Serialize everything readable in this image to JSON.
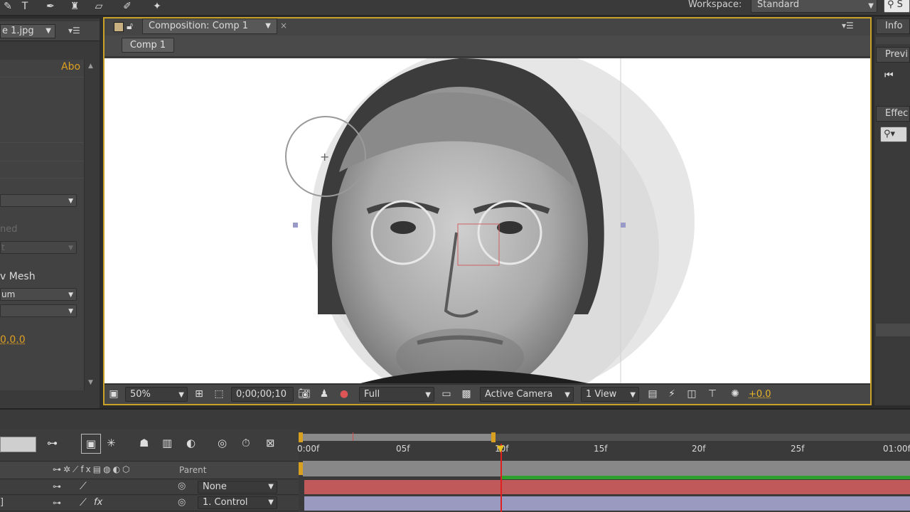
{
  "top_toolbar": {
    "workspace_label": "Workspace:",
    "workspace_value": "Standard",
    "search_text": "S"
  },
  "left_panel": {
    "tab_label": "e 1.jpg",
    "about_link": "Abo",
    "row_dimmed_1": "ned",
    "row_dimmed_2": "t",
    "mesh_label": "v Mesh",
    "select_um": "um",
    "value_text": "0,0.0"
  },
  "composition": {
    "tab_label": "Composition: Comp 1",
    "chip_label": "Comp 1",
    "footer": {
      "zoom": "50%",
      "timecode": "0;00;00;10",
      "resolution": "Full",
      "camera": "Active Camera",
      "views": "1 View",
      "exposure": "+0.0"
    }
  },
  "right_panels": {
    "info": "Info",
    "preview": "Previ",
    "effects": "Effec"
  },
  "timeline": {
    "ruler_ticks": [
      "0:00f",
      "05f",
      "10f",
      "15f",
      "20f",
      "25f",
      "01:00f"
    ],
    "parent_header": "Parent",
    "layers": [
      {
        "parent": "None"
      },
      {
        "parent": "1. Control"
      }
    ]
  },
  "colors": {
    "panel_highlight": "#c9a227",
    "accent_text": "#e8b42a",
    "track_red": "#c05a5a",
    "track_purple": "#9a9ac0",
    "cti": "#e02020"
  }
}
